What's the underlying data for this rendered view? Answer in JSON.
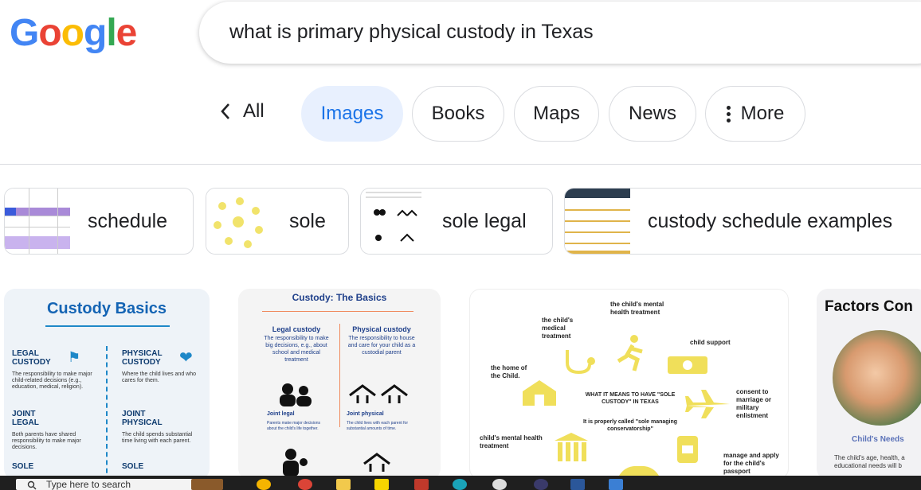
{
  "logo": {
    "letters": [
      "G",
      "o",
      "o",
      "g",
      "l",
      "e"
    ],
    "colors": [
      "#4285F4",
      "#EA4335",
      "#FBBC05",
      "#4285F4",
      "#34A853",
      "#EA4335"
    ]
  },
  "search": {
    "query": "what is primary physical custody in Texas"
  },
  "tabs": {
    "all": "All",
    "images": "Images",
    "books": "Books",
    "maps": "Maps",
    "news": "News",
    "more": "More",
    "active_color": "#1a73e8"
  },
  "chips": [
    {
      "label": "schedule",
      "icon": "calendar-thumbnail"
    },
    {
      "label": "sole",
      "icon": "diagram-thumbnail"
    },
    {
      "label": "sole legal",
      "icon": "infographic-thumbnail"
    },
    {
      "label": "custody schedule examples",
      "icon": "table-thumbnail"
    }
  ],
  "results": {
    "card1": {
      "title": "Custody Basics",
      "legal_heading": "LEGAL CUSTODY",
      "legal_text": "The responsibility to make major child-related decisions (e.g., education, medical, religion).",
      "physical_heading": "PHYSICAL CUSTODY",
      "physical_text": "Where the child lives and who cares for them.",
      "joint_legal_heading": "JOINT LEGAL",
      "joint_legal_text": "Both parents have shared responsibility to make major decisions.",
      "joint_physical_heading": "JOINT PHYSICAL",
      "joint_physical_text": "The child spends substantial time living with each parent.",
      "sole_legal_heading": "SOLE",
      "sole_physical_heading": "SOLE"
    },
    "card2": {
      "title": "Custody: The Basics",
      "legal_heading": "Legal custody",
      "legal_text": "The responsibility to make big decisions, e.g., about school and medical treatment",
      "physical_heading": "Physical custody",
      "physical_text": "The responsibility to house and care for your child as a custodial parent",
      "joint_legal": "Joint legal",
      "joint_legal_text": "Parents make major decisions about the child's life together.",
      "joint_physical": "Joint physical",
      "joint_physical_text": "The child lives with each parent for substantial amounts of time."
    },
    "card3": {
      "mental_health_treatment_top": "the child's mental health treatment",
      "medical_treatment": "the child's medical treatment",
      "child_support": "child support",
      "home": "the home of the Child.",
      "center_title": "WHAT IT MEANS TO HAVE \"SOLE CUSTODY\" IN TEXAS",
      "center_sub": "It is properly called \"sole managing conservatorship\"",
      "consent": "consent to marriage or military enlistment",
      "mental_health_left": "child's mental health treatment",
      "passport": "manage and apply for the child's passport"
    },
    "card4": {
      "title": "Factors Con",
      "sub": "Child's Needs",
      "text": "The child's age, health, a educational needs will b"
    }
  },
  "taskbar": {
    "search_placeholder": "Type here to search"
  }
}
